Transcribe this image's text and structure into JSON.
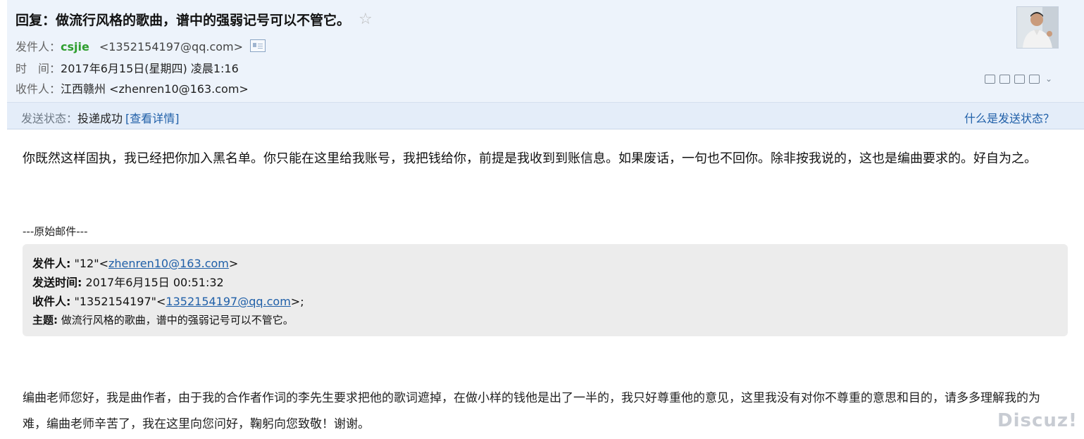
{
  "header": {
    "subject": "回复：做流行风格的歌曲，谱中的强弱记号可以不管它。",
    "from_label": "发件人：",
    "from_name": "csjie",
    "from_addr": "<1352154197@qq.com>",
    "time_label": "时　间：",
    "time_value": "2017年6月15日(星期四) 凌晨1:16",
    "to_label": "收件人：",
    "to_name": "江西赣州",
    "to_addr": "<zhenren10@163.com>"
  },
  "icons": {
    "star": "star-icon",
    "contact_card": "contact-card-icon",
    "toolbar": [
      "new-window-icon",
      "print-preview-icon",
      "download-icon",
      "print-icon",
      "chevron-down-icon"
    ]
  },
  "status": {
    "label": "发送状态：",
    "value": "投递成功",
    "detail_link": "[查看详情]",
    "help_link": "什么是发送状态？"
  },
  "body": {
    "text": "你既然这样固执，我已经把你加入黑名单。你只能在这里给我账号，我把钱给你，前提是我收到到账信息。如果废话，一句也不回你。除非按我说的，这也是编曲要求的。好自为之。"
  },
  "original": {
    "separator": "---原始邮件---",
    "from_label": "发件人:",
    "from_name": "\"12\"<",
    "from_email": "zhenren10@163.com",
    "from_close": ">",
    "date_label": "发送时间:",
    "date_value": "2017年6月15日 00:51:32",
    "to_label": "收件人:",
    "to_name": "\"1352154197\"<",
    "to_email": "1352154197@qq.com",
    "to_close": ">;",
    "subject_label": "主题:",
    "subject_value": "做流行风格的歌曲，谱中的强弱记号可以不管它。"
  },
  "bottom": {
    "text": "编曲老师您好，我是曲作者，由于我的合作者作词的李先生要求把他的歌词遮掉，在做小样的钱他是出了一半的，我只好尊重他的意见，这里我没有对你不尊重的意思和目的，请多多理解我的为难，编曲老师辛苦了，我在这里向您问好，鞠躬向您致敬！谢谢。"
  },
  "watermark": "Discuz!",
  "colors": {
    "header_bg": "#edf3fb",
    "status_bg": "#e4edf9",
    "sender_name": "#2e9e2e",
    "link": "#1f5fa8",
    "quote_bg": "#ececec"
  }
}
